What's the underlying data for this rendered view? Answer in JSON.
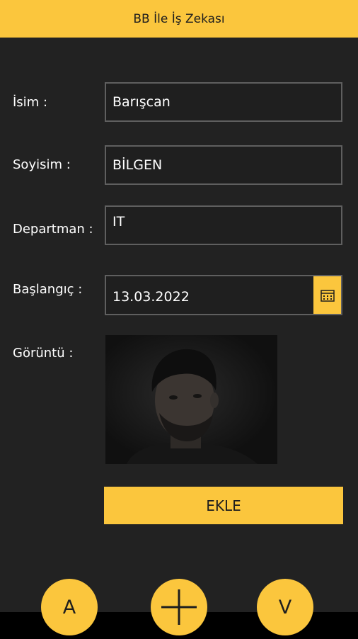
{
  "header": {
    "title": "BB İle İş Zekası"
  },
  "form": {
    "name_label": "İsim :",
    "name_value": "Barışcan",
    "surname_label": "Soyisim :",
    "surname_value": "BİLGEN",
    "department_label": "Departman :",
    "department_value": "IT",
    "start_label": "Başlangıç :",
    "start_value": "13.03.2022",
    "image_label": "Görüntü :"
  },
  "actions": {
    "add_label": "EKLE",
    "left_round_label": "A",
    "right_round_label": "V"
  },
  "icons": {
    "calendar": "calendar-icon",
    "plus": "plus-icon"
  },
  "colors": {
    "accent": "#fbc63d",
    "background": "#222222",
    "field_border": "#5f5f5f"
  }
}
